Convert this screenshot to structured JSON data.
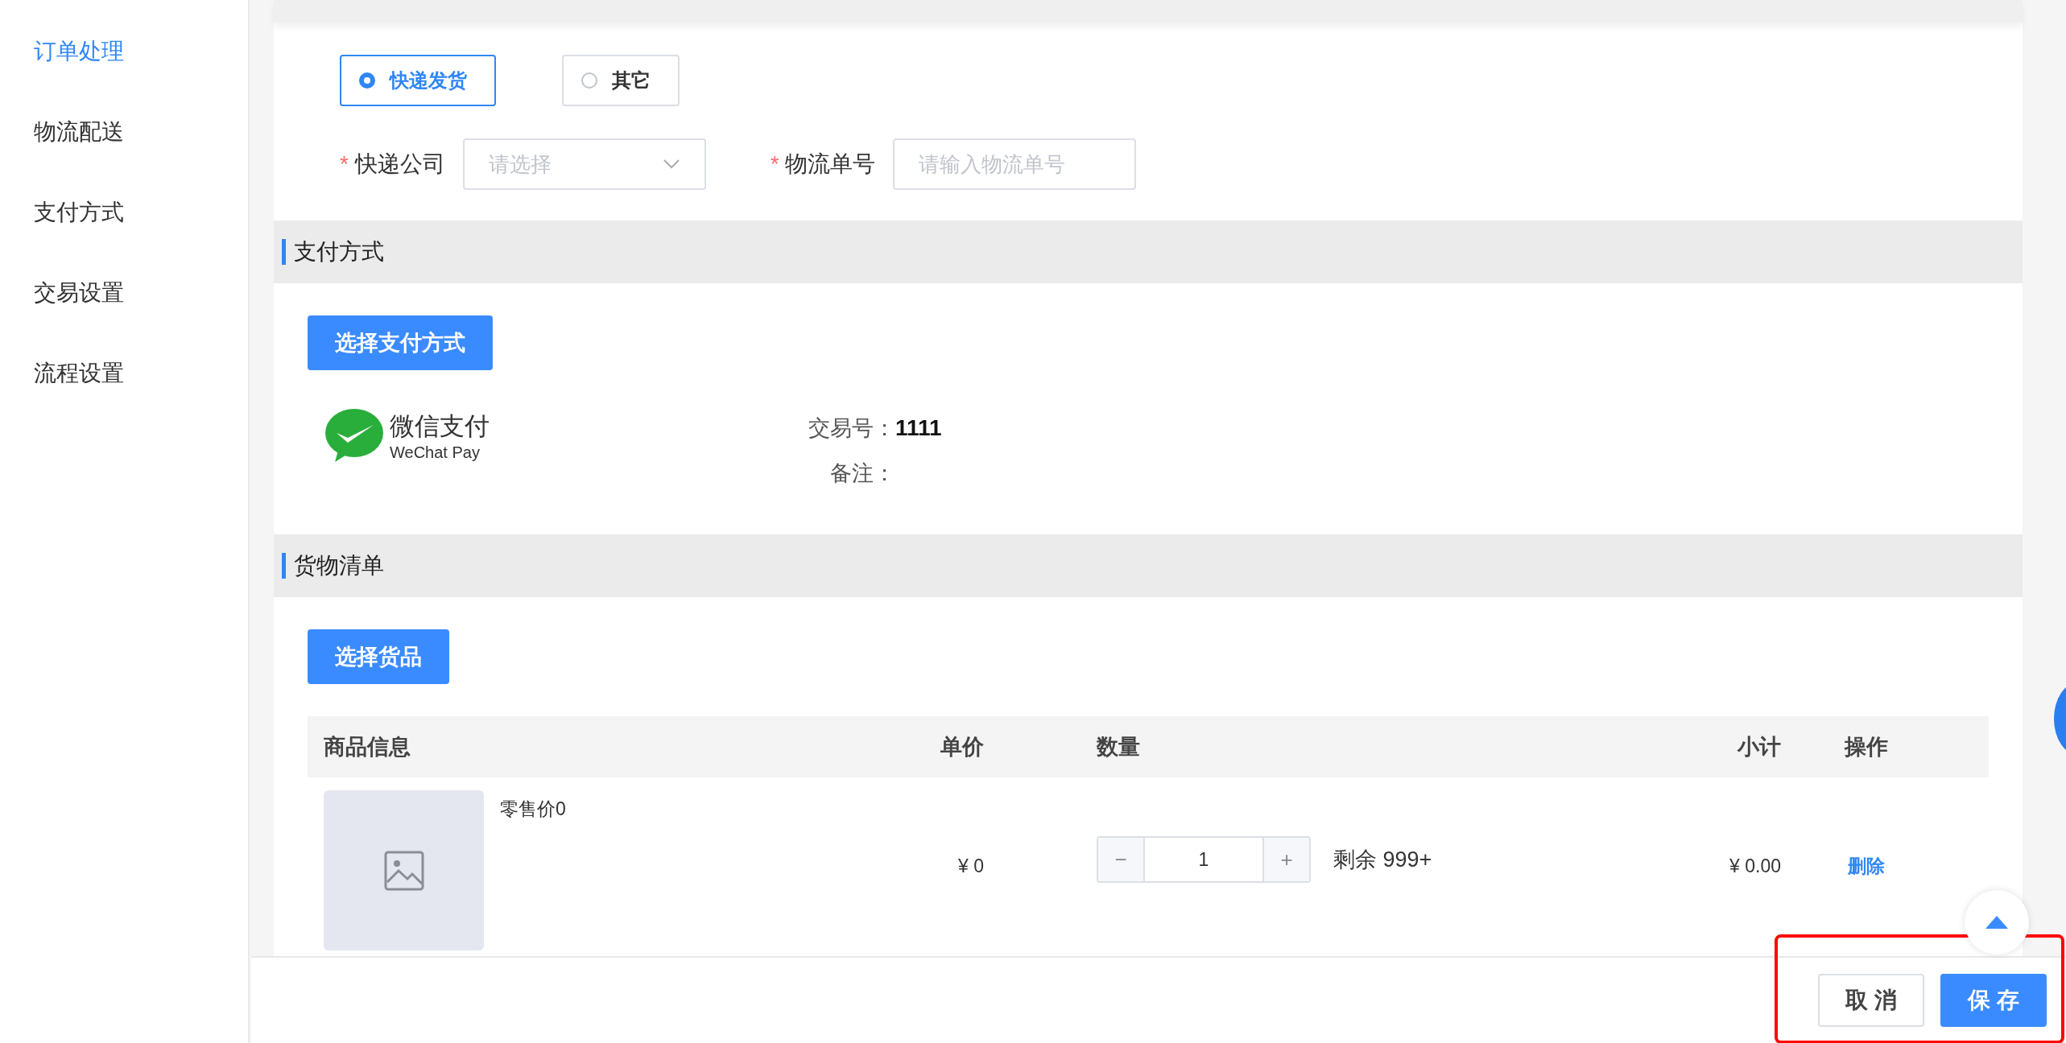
{
  "sidebar": {
    "items": [
      {
        "label": "订单处理",
        "selected": true
      },
      {
        "label": "物流配送",
        "selected": false
      },
      {
        "label": "支付方式",
        "selected": false
      },
      {
        "label": "交易设置",
        "selected": false
      },
      {
        "label": "流程设置",
        "selected": false
      }
    ]
  },
  "shipping": {
    "options": [
      {
        "label": "快递发货",
        "selected": true
      },
      {
        "label": "其它",
        "selected": false
      }
    ],
    "fields": [
      {
        "mark": "*",
        "label": "快递公司",
        "kind": "select",
        "placeholder": "请选择"
      },
      {
        "mark": "*",
        "label": "物流单号",
        "kind": "input",
        "placeholder": "请输入物流单号"
      }
    ]
  },
  "payment": {
    "title": "支付方式",
    "button": "选择支付方式",
    "logo": {
      "name": "微信支付",
      "subtitle": "WeChat Pay"
    },
    "details": [
      {
        "label": "交易号：",
        "value": "1111"
      },
      {
        "label": "备注："
      }
    ]
  },
  "goods": {
    "title": "货物清单",
    "button": "选择货品",
    "table": {
      "columns": [
        "商品信息",
        "单价",
        "数量",
        "小计",
        "操作"
      ],
      "rows": [
        {
          "name": "零售价0",
          "price": "¥ 0",
          "quantity": "1",
          "decrement": "−",
          "increment": "+",
          "stock": "剩余 999+",
          "subtotal": "¥ 0.00",
          "action": "删除"
        }
      ]
    }
  },
  "footer": {
    "buttons": [
      {
        "label": "取 消",
        "kind": "default"
      },
      {
        "label": "保 存",
        "kind": "primary"
      }
    ]
  }
}
